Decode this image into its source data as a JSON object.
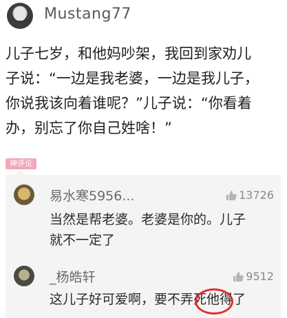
{
  "post": {
    "username": "Mustang77",
    "lines": [
      "儿子七岁，和他妈吵架，我回到家劝儿",
      "子说：“一边是我老婆，一边是我儿子，",
      "你说我该向着谁呢？”儿子说：“你看着",
      "办，别忘了你自己姓啥！”"
    ]
  },
  "tag": {
    "label": "神评论"
  },
  "comments": [
    {
      "name": "易水寒5956...",
      "likes": "13726",
      "lines": [
        "当然是帮老婆。老婆是你的。儿子",
        "就不一定了"
      ]
    },
    {
      "name": "_杨皓轩",
      "likes": "9512",
      "lines": [
        "这儿子好可爱啊，要不弄死他得了"
      ]
    }
  ],
  "colors": {
    "highlight_circle": "#e52b2b",
    "tag_bg": "#f0a8b8"
  }
}
